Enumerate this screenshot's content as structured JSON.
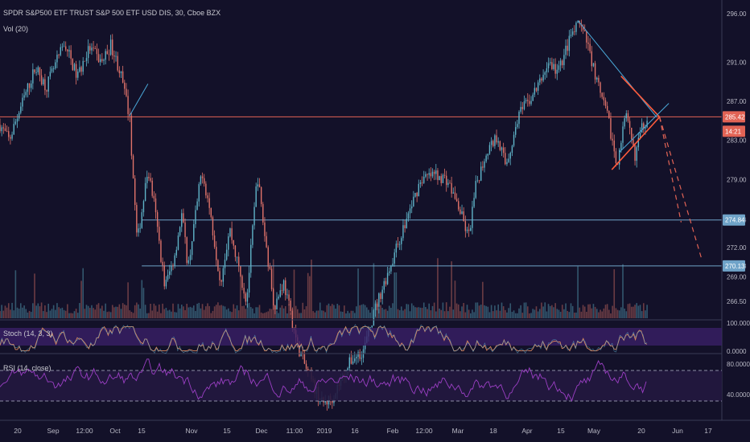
{
  "header": {
    "symbol_line": "SPDR S&P500 ETF TRUST S&P 500 ETF USD DIS, 30, Cboe BZX",
    "volume_label": "Vol (20)"
  },
  "colors": {
    "background": "#131129",
    "candle_up": "#5fb3c8",
    "candle_down": "#e0736a",
    "hline_red": "#e26355",
    "hline_blue": "#6fa3c8",
    "trend_red": "#ff5b3b",
    "trend_blue": "#4aa8d8",
    "projection": "#e26355",
    "stoch_line": "#d9875e",
    "stoch_band": "#3a1f66",
    "rsi_line": "#9b3fc4",
    "rsi_band": "#24183f",
    "axis_text": "#b8b8c4"
  },
  "chart_data": [
    {
      "type": "candlestick",
      "title": "SPDR S&P500 ETF TRUST S&P 500 ETF USD DIS, 30, Cboe BZX",
      "y_ticks": [
        "296.00",
        "291.00",
        "287.00",
        "283.00",
        "279.00",
        "274.84",
        "272.00",
        "270.13",
        "269.00",
        "266.50"
      ],
      "price_labels": [
        {
          "value": "285.42",
          "color": "#e26355"
        },
        {
          "value": "14:21",
          "color": "#e26355"
        },
        {
          "value": "274.84",
          "color": "#6fa3c8"
        },
        {
          "value": "270.13",
          "color": "#6fa3c8"
        }
      ],
      "horizontal_levels": [
        285.42,
        274.84,
        270.13
      ],
      "x_ticks": [
        "20",
        "Sep",
        "12:00",
        "Oct",
        "15",
        "Nov",
        "15",
        "Dec",
        "11:00",
        "2019",
        "16",
        "Feb",
        "12:00",
        "Mar",
        "18",
        "Apr",
        "15",
        "May",
        "20",
        "Jun",
        "17"
      ],
      "path_keypoints": [
        {
          "x": 0.0,
          "y": 284.6
        },
        {
          "x": 0.6,
          "y": 283.0
        },
        {
          "x": 1.2,
          "y": 285.8
        },
        {
          "x": 2.3,
          "y": 290.5
        },
        {
          "x": 3.0,
          "y": 288.5
        },
        {
          "x": 4.2,
          "y": 293.0
        },
        {
          "x": 5.0,
          "y": 289.5
        },
        {
          "x": 5.8,
          "y": 292.5
        },
        {
          "x": 6.6,
          "y": 291.0
        },
        {
          "x": 7.2,
          "y": 292.8
        },
        {
          "x": 7.8,
          "y": 290.0
        },
        {
          "x": 8.4,
          "y": 285.5
        },
        {
          "x": 8.9,
          "y": 272.5
        },
        {
          "x": 9.6,
          "y": 280.0
        },
        {
          "x": 10.0,
          "y": 276.5
        },
        {
          "x": 10.7,
          "y": 268.0
        },
        {
          "x": 11.3,
          "y": 271.0
        },
        {
          "x": 11.8,
          "y": 275.5
        },
        {
          "x": 12.2,
          "y": 270.0
        },
        {
          "x": 13.1,
          "y": 280.0
        },
        {
          "x": 13.6,
          "y": 276.0
        },
        {
          "x": 14.3,
          "y": 268.5
        },
        {
          "x": 14.9,
          "y": 274.0
        },
        {
          "x": 15.4,
          "y": 270.5
        },
        {
          "x": 16.0,
          "y": 266.5
        },
        {
          "x": 16.7,
          "y": 279.5
        },
        {
          "x": 17.2,
          "y": 273.0
        },
        {
          "x": 17.8,
          "y": 266.0
        },
        {
          "x": 18.4,
          "y": 268.5
        },
        {
          "x": 19.3,
          "y": 262.0
        },
        {
          "x": 20.0,
          "y": 259.0
        },
        {
          "x": 20.9,
          "y": 256.0
        },
        {
          "x": 21.5,
          "y": 256.5
        },
        {
          "x": 22.8,
          "y": 260.5
        },
        {
          "x": 23.6,
          "y": 261.5
        },
        {
          "x": 24.4,
          "y": 266.0
        },
        {
          "x": 25.4,
          "y": 270.5
        },
        {
          "x": 26.3,
          "y": 274.5
        },
        {
          "x": 27.3,
          "y": 279.0
        },
        {
          "x": 28.3,
          "y": 279.5
        },
        {
          "x": 29.0,
          "y": 279.0
        },
        {
          "x": 29.8,
          "y": 276.0
        },
        {
          "x": 30.4,
          "y": 273.0
        },
        {
          "x": 30.9,
          "y": 278.5
        },
        {
          "x": 31.6,
          "y": 282.0
        },
        {
          "x": 32.3,
          "y": 283.5
        },
        {
          "x": 32.8,
          "y": 280.5
        },
        {
          "x": 33.3,
          "y": 283.0
        },
        {
          "x": 33.6,
          "y": 285.5
        },
        {
          "x": 34.4,
          "y": 287.2
        },
        {
          "x": 35.0,
          "y": 288.8
        },
        {
          "x": 35.6,
          "y": 291.0
        },
        {
          "x": 36.2,
          "y": 290.0
        },
        {
          "x": 37.0,
          "y": 293.5
        },
        {
          "x": 37.6,
          "y": 295.0
        },
        {
          "x": 38.2,
          "y": 292.5
        },
        {
          "x": 38.9,
          "y": 288.0
        },
        {
          "x": 39.5,
          "y": 285.0
        },
        {
          "x": 40.0,
          "y": 280.5
        },
        {
          "x": 40.6,
          "y": 285.5
        },
        {
          "x": 41.2,
          "y": 281.5
        },
        {
          "x": 41.7,
          "y": 284.5
        },
        {
          "x": 42.0,
          "y": 285.3
        }
      ],
      "trend_lines": [
        {
          "color": "trend_blue",
          "from": {
            "x": 37.5,
            "y": 295.3
          },
          "to": {
            "x": 42.6,
            "y": 285.4
          }
        },
        {
          "color": "trend_red",
          "from": {
            "x": 40.3,
            "y": 289.6
          },
          "to": {
            "x": 42.8,
            "y": 285.4
          }
        },
        {
          "color": "trend_red",
          "from": {
            "x": 39.7,
            "y": 280.0
          },
          "to": {
            "x": 42.8,
            "y": 285.4
          }
        },
        {
          "color": "trend_blue",
          "from": {
            "x": 40.2,
            "y": 281.8
          },
          "to": {
            "x": 43.4,
            "y": 286.8
          }
        },
        {
          "color": "trend_blue",
          "from": {
            "x": 8.4,
            "y": 285.5
          },
          "to": {
            "x": 9.6,
            "y": 288.8
          }
        }
      ],
      "projections": [
        {
          "from": {
            "x": 42.8,
            "y": 285.4
          },
          "to": {
            "x": 44.2,
            "y": 274.6
          }
        },
        {
          "from": {
            "x": 42.8,
            "y": 285.4
          },
          "to": {
            "x": 45.5,
            "y": 271.0
          }
        }
      ]
    },
    {
      "type": "line",
      "title": "Stoch (14, 3, 3)",
      "y_ticks": [
        "100.0000",
        "0.0000"
      ],
      "band": [
        20,
        80
      ]
    },
    {
      "type": "line",
      "title": "RSI (14, close)",
      "y_ticks": [
        "80.0000",
        "40.0000"
      ],
      "band": [
        30,
        70
      ]
    }
  ]
}
